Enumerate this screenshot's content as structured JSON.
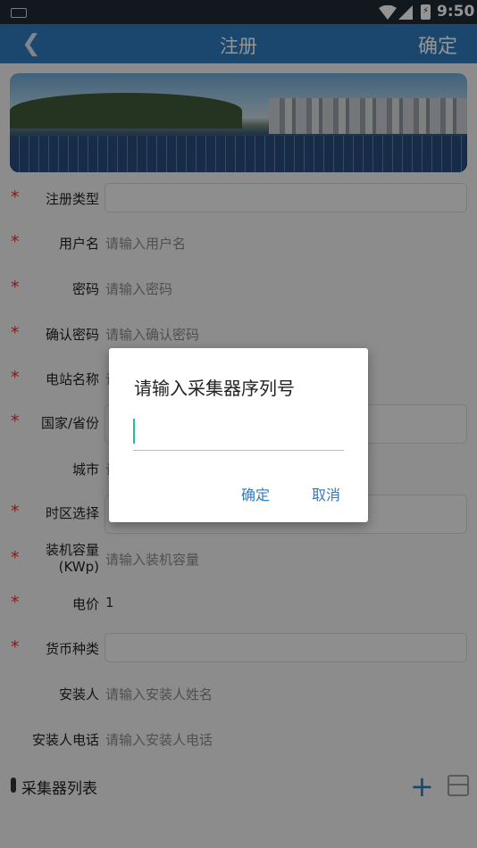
{
  "status_bar": {
    "time": "9:50",
    "battery_icon": "battery-charging-icon"
  },
  "app_bar": {
    "back_icon": "chevron-left-icon",
    "title": "注册",
    "confirm_label": "确定"
  },
  "banner": {
    "image": "solar-panels-city-banner"
  },
  "form": {
    "fields": [
      {
        "label": "注册类型",
        "required": true,
        "type": "select",
        "value": ""
      },
      {
        "label": "用户名",
        "required": true,
        "type": "text",
        "placeholder": "请输入用户名"
      },
      {
        "label": "密码",
        "required": true,
        "type": "password",
        "placeholder": "请输入密码"
      },
      {
        "label": "确认密码",
        "required": true,
        "type": "password",
        "placeholder": "请输入确认密码"
      },
      {
        "label": "电站名称",
        "required": true,
        "type": "text",
        "placeholder": "请"
      },
      {
        "label": "国家/省份",
        "required": true,
        "type": "select",
        "value": ""
      },
      {
        "label": "城市",
        "required": false,
        "type": "text",
        "placeholder": "请"
      },
      {
        "label": "时区选择",
        "required": true,
        "type": "select",
        "value": ""
      },
      {
        "label_line1": "装机容量",
        "label_line2": "(KWp)",
        "required": true,
        "type": "text",
        "placeholder": "请输入装机容量"
      },
      {
        "label": "电价",
        "required": true,
        "type": "text",
        "value": "1"
      },
      {
        "label": "货币种类",
        "required": true,
        "type": "select",
        "value": ""
      },
      {
        "label": "安装人",
        "required": false,
        "type": "text",
        "placeholder": "请输入安装人姓名"
      },
      {
        "label": "安装人电话",
        "required": false,
        "type": "text",
        "placeholder": "请输入安装人电话"
      }
    ],
    "required_mark": "*"
  },
  "collector_section": {
    "title": "采集器列表",
    "add_icon": "plus-icon",
    "scan_icon": "scan-icon"
  },
  "dialog": {
    "title": "请输入采集器序列号",
    "input_value": "",
    "ok_label": "确定",
    "cancel_label": "取消"
  },
  "colors": {
    "primary": "#2f7bbd",
    "required": "#e0302d",
    "cursor": "#2bb5a4"
  }
}
